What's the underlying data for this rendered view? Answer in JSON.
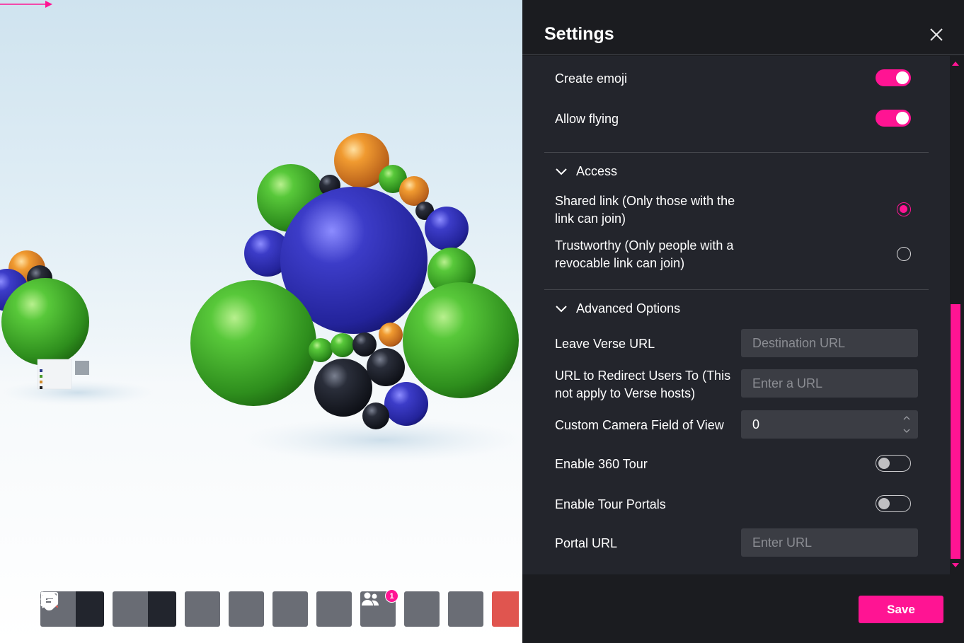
{
  "settings": {
    "title": "Settings",
    "toggles": {
      "create_emoji": {
        "label": "Create emoji",
        "on": true
      },
      "allow_flying": {
        "label": "Allow flying",
        "on": true
      },
      "enable_360_tour": {
        "label": "Enable 360 Tour",
        "on": false
      },
      "enable_tour_portals": {
        "label": "Enable Tour Portals",
        "on": false
      }
    },
    "access": {
      "heading": "Access",
      "options": [
        {
          "line1": "Shared link (Only those with the",
          "line2": "link can join)",
          "selected": true
        },
        {
          "line1": "Trustworthy (Only people with a",
          "line2": "revocable link can join)",
          "selected": false
        }
      ]
    },
    "advanced": {
      "heading": "Advanced Options",
      "leave_url": {
        "label": "Leave Verse URL",
        "placeholder": "Destination URL"
      },
      "redirect_url": {
        "label_line1": "URL to Redirect Users To (This",
        "label_line2": "not apply to Verse hosts)",
        "placeholder": "Enter a URL"
      },
      "camera_fov": {
        "label": "Custom Camera Field of View",
        "value": "0"
      },
      "portal_url": {
        "label": "Portal URL",
        "placeholder": "Enter URL"
      }
    },
    "save_label": "Save"
  },
  "toolbar": {
    "buttons": [
      "mic-off-icon",
      "chevron-up-icon",
      "camera-off-icon",
      "chevron-up-icon",
      "share-screen-icon",
      "emoji-icon",
      "raise-hand-icon",
      "add-icon",
      "people-icon",
      "chat-icon",
      "more-icon",
      "leave-icon"
    ],
    "people_badge": "1"
  },
  "colors": {
    "accent": "#ff1493",
    "panel_bg": "#23252c",
    "header_bg": "#1b1c20",
    "input_bg": "#3b3d44",
    "leave_red": "#e0554f"
  }
}
